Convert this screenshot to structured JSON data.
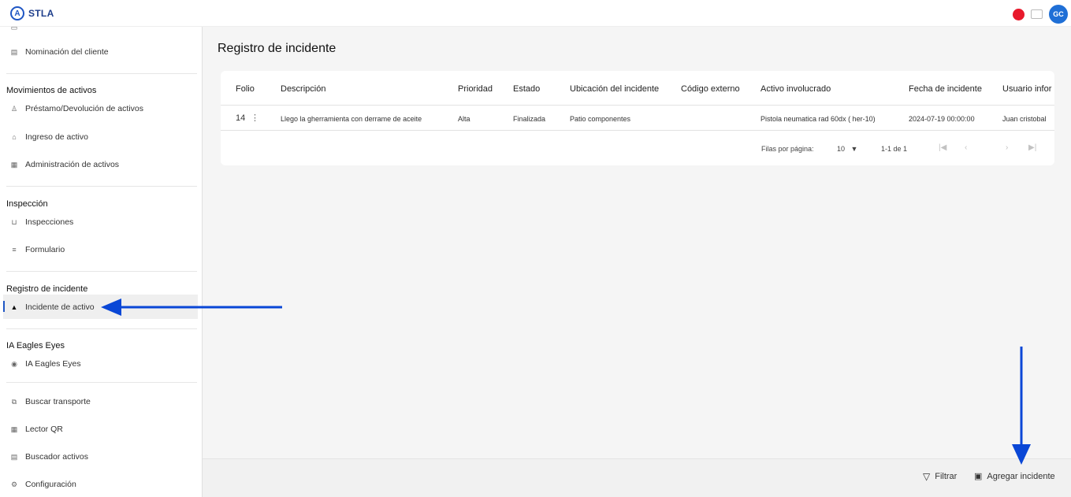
{
  "app": {
    "name": "STLA",
    "logo_glyph": "A"
  },
  "header": {
    "avatar_initials": "GC",
    "record_color": "#e8192c"
  },
  "sidebar": {
    "items_top": [
      {
        "label": "Nominación del cliente",
        "icon": "clipboard-icon"
      }
    ],
    "sections": [
      {
        "title": "Movimientos de activos",
        "items": [
          {
            "label": "Préstamo/Devolución de activos",
            "icon": "user-transfer-icon"
          },
          {
            "label": "Ingreso de activo",
            "icon": "bag-icon"
          },
          {
            "label": "Administración de activos",
            "icon": "building-icon"
          }
        ]
      },
      {
        "title": "Inspección",
        "items": [
          {
            "label": "Inspecciones",
            "icon": "inbox-icon"
          },
          {
            "label": "Formulario",
            "icon": "list-icon"
          }
        ]
      },
      {
        "title": "Registro de incidente",
        "items": [
          {
            "label": "Incidente de activo",
            "icon": "warning-icon",
            "active": true
          }
        ]
      },
      {
        "title": "IA Eagles Eyes",
        "items": [
          {
            "label": "IA Eagles Eyes",
            "icon": "eye-icon"
          }
        ]
      }
    ],
    "items_bottom": [
      {
        "label": "Buscar transporte",
        "icon": "truck-search-icon"
      },
      {
        "label": "Lector QR",
        "icon": "qr-icon"
      },
      {
        "label": "Buscador activos",
        "icon": "search-doc-icon"
      },
      {
        "label": "Configuración",
        "icon": "gear-icon"
      }
    ]
  },
  "main": {
    "title": "Registro de incidente",
    "table": {
      "columns": [
        "Folio",
        "Descripción",
        "Prioridad",
        "Estado",
        "Ubicación del incidente",
        "Código externo",
        "Activo involucrado",
        "Fecha de incidente",
        "Usuario infor"
      ],
      "rows": [
        {
          "folio": "14",
          "descripcion": "Llego la gherramienta con derrame de aceite",
          "prioridad": "Alta",
          "estado": "Finalizada",
          "ubicacion": "Patio componentes",
          "codigo": "",
          "activo": "Pistola neumatica rad 60dx ( her-10)",
          "fecha": "2024-07-19 00:00:00",
          "usuario": "Juan cristobal"
        }
      ]
    },
    "pagination": {
      "rows_per_page_label": "Filas por página:",
      "rows_per_page_value": "10",
      "range": "1-1 de 1"
    }
  },
  "footer": {
    "filter_label": "Filtrar",
    "add_label": "Agregar incidente"
  },
  "annotation_color": "#0a47d6"
}
